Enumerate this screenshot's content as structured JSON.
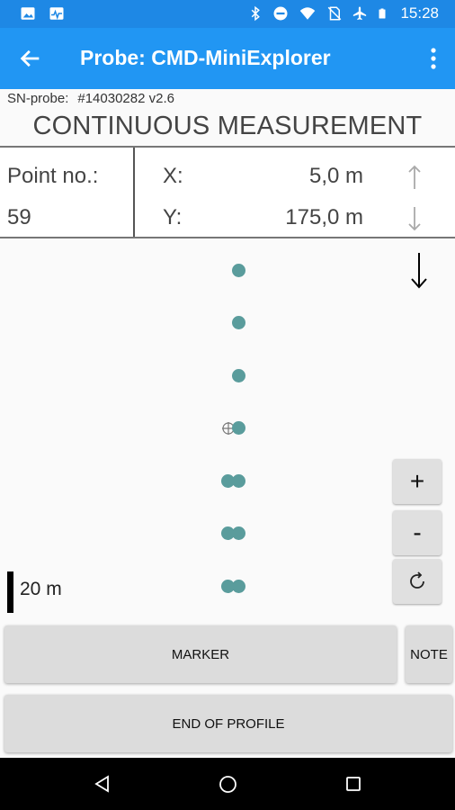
{
  "status_bar": {
    "time": "15:28",
    "icons": [
      "image-icon",
      "activity-icon",
      "bluetooth-icon",
      "dnd-icon",
      "wifi-icon",
      "no-sim-icon",
      "airplane-icon",
      "battery-icon"
    ]
  },
  "app_bar": {
    "title": "Probe: CMD-MiniExplorer",
    "back_icon": "arrow-left-icon",
    "menu_icon": "more-vert-icon"
  },
  "probe": {
    "sn_label": "SN-probe:",
    "sn_value": "#14030282 v2.6"
  },
  "mode_title": "CONTINUOUS MEASUREMENT",
  "measurement": {
    "point_label": "Point no.:",
    "point_value": "59",
    "x_label": "X:",
    "x_value": "5,0 m",
    "y_label": "Y:",
    "y_value": "175,0 m"
  },
  "map": {
    "scale_label": "20 m",
    "zoom_in_label": "+",
    "zoom_out_label": "-",
    "rotate_icon": "rotate-icon",
    "direction_icon": "arrow-down-icon"
  },
  "buttons": {
    "marker": "MARKER",
    "note": "NOTE",
    "end_profile": "END OF PROFILE"
  },
  "colors": {
    "status_bar": "#1e88e5",
    "app_bar": "#2196f3",
    "dot": "#5a9c9c",
    "button": "#dcdcdc"
  }
}
